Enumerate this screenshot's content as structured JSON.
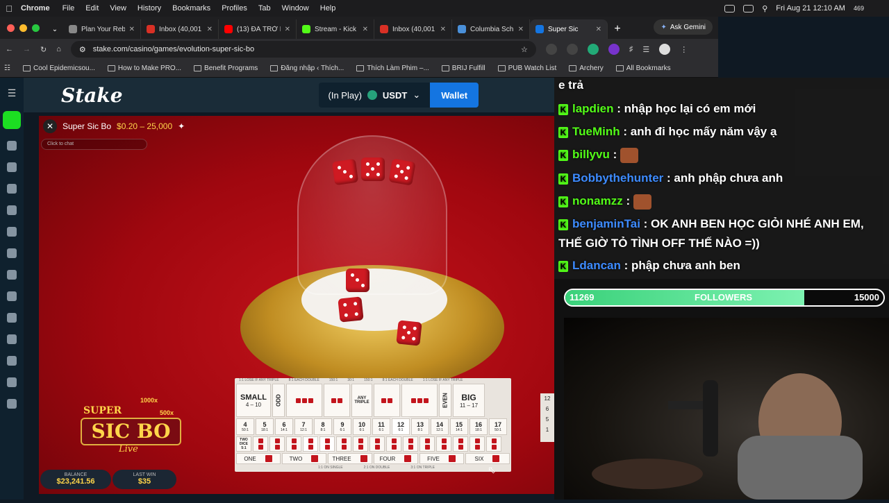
{
  "menubar": {
    "app": "Chrome",
    "items": [
      "File",
      "Edit",
      "View",
      "History",
      "Bookmarks",
      "Profiles",
      "Tab",
      "Window",
      "Help"
    ],
    "datetime": "Fri Aug 21 12:10 AM",
    "badge": "469"
  },
  "tabs": [
    {
      "label": "Plan Your Reb",
      "color": "#888"
    },
    {
      "label": "Inbox (40,001",
      "color": "#d93025"
    },
    {
      "label": "(13) ĐÃ TRỞ L",
      "color": "#ff0000"
    },
    {
      "label": "Stream - Kick",
      "color": "#53fc18"
    },
    {
      "label": "Inbox (40,001",
      "color": "#d93025"
    },
    {
      "label": "Columbia Sch",
      "color": "#4a90d9"
    },
    {
      "label": "Super Sic",
      "color": "#1475e1"
    }
  ],
  "gemini": "Ask Gemini",
  "url": "stake.com/casino/games/evolution-super-sic-bo",
  "bookmarks": [
    "Cool Epidemicsou...",
    "How to Make PRO...",
    "Benefit Programs",
    "Đăng nhập ‹ Thích...",
    "Thích Làm Phim –...",
    "BRIJ Fulfill",
    "PUB Watch List",
    "Archery",
    "All Bookmarks"
  ],
  "stake": {
    "logo": "Stake",
    "inplay": "(In Play)",
    "currency": "USDT",
    "wallet": "Wallet"
  },
  "game": {
    "title": "Super Sic Bo",
    "limits": "$0.20 – 25,000",
    "chat_placeholder": "Click to chat",
    "balance_label": "BALANCE",
    "balance": "$23,241.56",
    "lastwin_label": "LAST WIN",
    "lastwin": "$35",
    "logo_top": "SUPER",
    "logo_main": "SIC BO",
    "logo_sub": "Live",
    "logo_mult1": "1000x",
    "logo_mult2": "500x"
  },
  "board": {
    "header": [
      "1:1 LOSE IF ANY TRIPLE",
      "8:1 EACH DOUBLE",
      "150:1",
      "30:1",
      "150:1",
      "8:1 EACH DOUBLE",
      "1:1 LOSE IF ANY TRIPLE"
    ],
    "small": "SMALL",
    "small_range": "4 – 10",
    "odd": "ODD",
    "any_triple": "ANY TRIPLE",
    "even": "EVEN",
    "big": "BIG",
    "big_range": "11 – 17",
    "totals": [
      "4",
      "5",
      "6",
      "7",
      "8",
      "9",
      "10",
      "11",
      "12",
      "13",
      "14",
      "15",
      "16",
      "17"
    ],
    "payouts": [
      "50:1",
      "18:1",
      "14:1",
      "12:1",
      "8:1",
      "6:1",
      "6:1",
      "6:1",
      "6:1",
      "8:1",
      "12:1",
      "14:1",
      "18:1",
      "50:1"
    ],
    "singles": [
      "ONE",
      "TWO",
      "THREE",
      "FOUR",
      "FIVE",
      "SIX"
    ],
    "footer": [
      "1:1 ON SINGLE",
      "2:1 ON DOUBLE",
      "3:1 ON TRIPLE"
    ],
    "two_dice": "TWO DICE 5:1",
    "history": [
      "12",
      "6",
      "5",
      "1"
    ]
  },
  "chat": [
    {
      "user": "",
      "text": "e trả",
      "y": 0
    },
    {
      "user": "lapdien",
      "text": "nhập học lại có em mới",
      "blue": false
    },
    {
      "user": "TueMinh",
      "text": "anh đi học mấy năm vậy ạ",
      "blue": false
    },
    {
      "user": "billyvu",
      "text": "",
      "blue": false
    },
    {
      "user": "Bobbythehunter",
      "text": "anh phập chưa anh",
      "blue": true
    },
    {
      "user": "nonamzz",
      "text": "",
      "blue": false
    },
    {
      "user": "benjaminTai",
      "text": "OK ANH BEN HỌC GIỎI NHÉ ANH EM,",
      "blue": true
    },
    {
      "user": "",
      "text": "THẾ GIỜ TỎ TÌNH OFF THẾ NÀO =))",
      "blue": false
    },
    {
      "user": "Ldancan",
      "text": "phập chưa anh ben",
      "blue": true
    }
  ],
  "followers": {
    "current": "11269",
    "label": "FOLLOWERS",
    "goal": "15000",
    "fraction": 0.7513
  },
  "colors": {
    "stake_bg": "#0f212e",
    "stake_green": "#1fff20",
    "wallet": "#1475e1",
    "kick_green": "#53fc18"
  }
}
